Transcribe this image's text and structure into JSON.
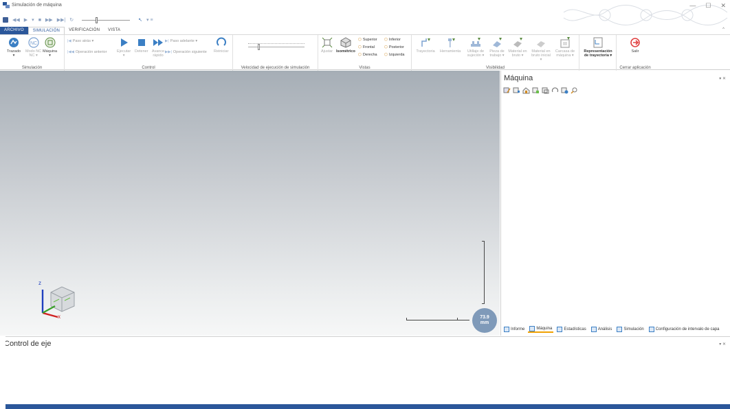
{
  "window": {
    "title": "Simulación de máquina",
    "controls": {
      "minimize": "—",
      "maximize": "☐",
      "close": "✕"
    }
  },
  "qat": {
    "dropdown": "▾ ≡"
  },
  "tabs": [
    "ARCHIVO",
    "SIMULACIÓN",
    "VERIFICACIÓN",
    "VISTA"
  ],
  "ribbon_collapse": "^",
  "ribbon": {
    "simulacion": {
      "label": "Simulación",
      "buttons": [
        "Trazado",
        "Modo NC",
        "Máquina"
      ],
      "sub": [
        "▾",
        "NC ▾",
        "▾"
      ]
    },
    "control": {
      "label": "Control",
      "paso_atras": "Paso atrás ▾",
      "operacion_anterior": "Operación anterior",
      "ejecutar": "Ejecutar",
      "detener": "Detener",
      "avance_rapido": "Avance rápido",
      "paso_adelante": "Paso adelante ▾",
      "operacion_siguiente": "Operación siguiente",
      "reiniciar": "Reiniciar",
      "ejecutar_sub": "▾"
    },
    "velocidad": {
      "label": "Velocidad de ejecución de simulación",
      "value_fraction": 0.18
    },
    "vistas": {
      "label": "Vistas",
      "ajustar": "Ajustar",
      "isometrico": "Isométrico",
      "superior": "Superior",
      "inferior": "Inferior",
      "frontal": "Frontal",
      "posterior": "Posterior",
      "derecha": "Derecha",
      "izquierda": "Izquierda"
    },
    "visibilidad": {
      "label": "Visibilidad",
      "items": [
        "Trayectoria",
        "Herramienta",
        "Utillaje de sujeción ▾",
        "Pieza de trabajo ▾",
        "Material en bruto ▾",
        "Material en bruto inicial ▾",
        "Carcasa de máquina ▾"
      ]
    },
    "representacion": {
      "label": "Representación de trayectoria ▾"
    },
    "cerrar": {
      "label": "Cerrar aplicación",
      "salir": "Salir"
    }
  },
  "viewport": {
    "axis_x": "x",
    "axis_z": "z",
    "scale_value": "73.9",
    "scale_unit": "mm"
  },
  "right_panel": {
    "title": "Máquina",
    "ctrls": "▾ ✕",
    "tabs": [
      "Informe",
      "Máquina",
      "Estadísticas",
      "Análisis",
      "Simulación",
      "Configuración de intervalo de capa"
    ]
  },
  "bottom_panel": {
    "title": "Control de eje",
    "ctrls": "▾ ✕"
  },
  "colors": {
    "accent": "#2b579a",
    "orange": "#f0a000"
  }
}
